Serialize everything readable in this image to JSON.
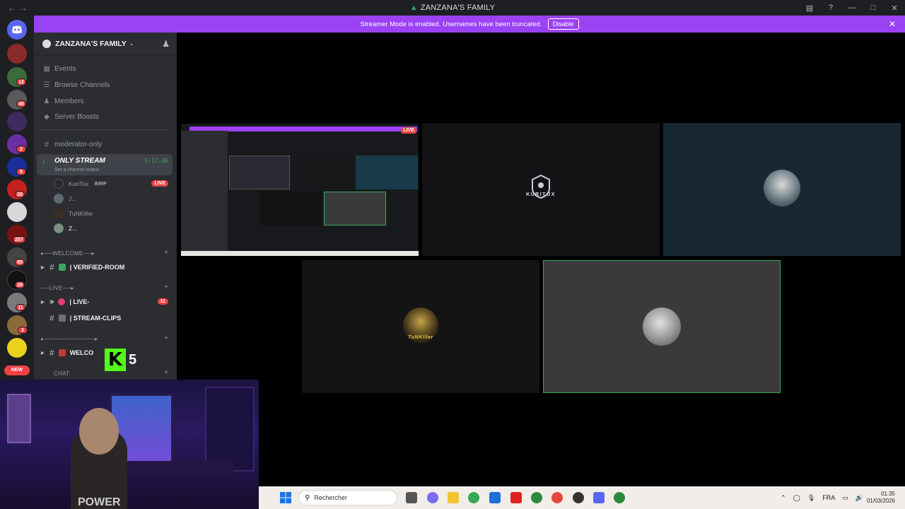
{
  "window": {
    "title": "ZANZANA'S FAMILY"
  },
  "banner": {
    "message": "Streamer Mode is enabled. Usernames have been truncated.",
    "disable_label": "Disable"
  },
  "rail_badges": [
    "12",
    "46",
    "2",
    "5",
    "20",
    "257",
    "65",
    "26",
    "11",
    "3"
  ],
  "new_label": "NEW",
  "server": {
    "name": "ZANZANA'S FAMILY",
    "menu": [
      "Events",
      "Browse Channels",
      "Members",
      "Server Boosts"
    ],
    "moderator_channel": "moderator-only",
    "voice_channel": {
      "name": "ONLY STREAM",
      "timer": "5:17:46",
      "status": "Set a channel status"
    },
    "members": [
      {
        "name": "KuriTox",
        "tag": "IMRP",
        "live": "LIVE"
      },
      {
        "name": "J..."
      },
      {
        "name": "TuNKiller"
      },
      {
        "name": "Z..."
      }
    ],
    "categories": [
      {
        "label": "▸──WELCOME──▸"
      },
      {
        "label": "──LIVE──▸"
      },
      {
        "label": "▸────────────▸"
      },
      {
        "label": "CHAT"
      }
    ],
    "channels": [
      {
        "name": "| VERIFIED-ROOM"
      },
      {
        "name": "| LIVE-",
        "mentions": "11"
      },
      {
        "name": "| STREAM-CLIPS"
      },
      {
        "name": "WELCO"
      }
    ]
  },
  "stream_tiles": [
    {
      "label": "",
      "live": "LIVE"
    },
    {
      "label": "KURITOX"
    },
    {
      "label": ""
    },
    {
      "label": "TuNKiller"
    },
    {
      "label": ""
    }
  ],
  "overlay": {
    "logo_letter": "K",
    "count": "5"
  },
  "webcam_text": "POWER",
  "taskbar": {
    "search_placeholder": "Rechercher",
    "language": "FRA",
    "time": "01:35",
    "date": "01/03/2026"
  }
}
